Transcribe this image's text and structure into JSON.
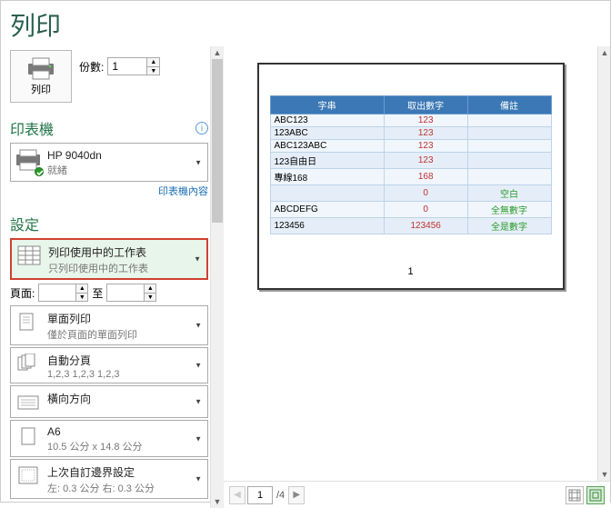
{
  "pageTitle": "列印",
  "printButtonLabel": "列印",
  "copies": {
    "label": "份數:",
    "value": "1"
  },
  "printer": {
    "sectionTitle": "印表機",
    "name": "HP 9040dn",
    "status": "就緒",
    "propertiesLink": "印表機內容"
  },
  "settings": {
    "sectionTitle": "設定",
    "printWhat": {
      "title": "列印使用中的工作表",
      "sub": "只列印使用中的工作表"
    },
    "pageRange": {
      "label": "頁面:",
      "toLabel": "至",
      "from": "",
      "to": ""
    },
    "sides": {
      "title": "單面列印",
      "sub": "僅於頁面的單面列印"
    },
    "collate": {
      "title": "自動分頁",
      "sub": "1,2,3   1,2,3   1,2,3"
    },
    "orientation": {
      "title": "橫向方向",
      "sub": ""
    },
    "paperSize": {
      "title": "A6",
      "sub": "10.5 公分 x 14.8 公分"
    },
    "margins": {
      "title": "上次自訂邊界設定",
      "sub": "左: 0.3 公分  右: 0.3 公分"
    }
  },
  "preview": {
    "headers": [
      "字串",
      "取出數字",
      "備註"
    ],
    "rows": [
      {
        "c1": "ABC123",
        "c2": "123",
        "c3": ""
      },
      {
        "c1": "123ABC",
        "c2": "123",
        "c3": ""
      },
      {
        "c1": "ABC123ABC",
        "c2": "123",
        "c3": ""
      },
      {
        "c1": "123自由日",
        "c2": "123",
        "c3": ""
      },
      {
        "c1": "專線168",
        "c2": "168",
        "c3": ""
      },
      {
        "c1": "",
        "c2": "0",
        "c3": "空白"
      },
      {
        "c1": "ABCDEFG",
        "c2": "0",
        "c3": "全無數字"
      },
      {
        "c1": "123456",
        "c2": "123456",
        "c3": "全是數字"
      }
    ],
    "pageNumber": "1",
    "navCurrent": "1",
    "navTotal": "/4"
  }
}
